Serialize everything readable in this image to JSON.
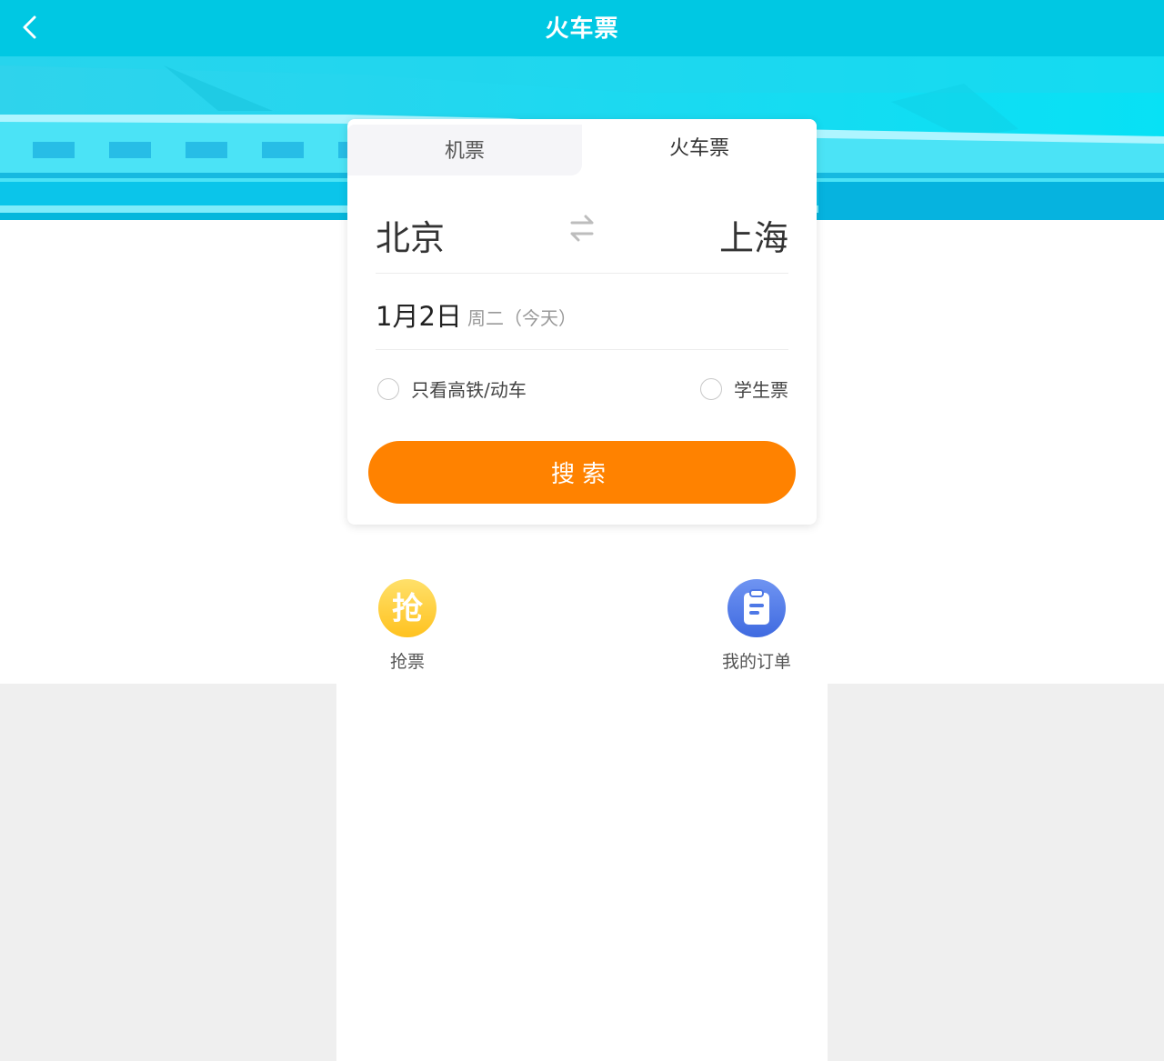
{
  "header": {
    "title": "火车票",
    "back_icon": "chevron-left-icon"
  },
  "colors": {
    "header_bg": "#00c8e3",
    "accent_orange": "#ff8200",
    "page_bg": "#efefef"
  },
  "tabs": [
    {
      "label": "机票",
      "active": false
    },
    {
      "label": "火车票",
      "active": true
    }
  ],
  "route": {
    "from": "北京",
    "to": "上海",
    "swap_icon": "swap-arrows-icon"
  },
  "date": {
    "main": "1月2日",
    "sub": "周二（今天）"
  },
  "options": {
    "high_speed_only": {
      "label": "只看高铁/动车",
      "checked": false
    },
    "student_ticket": {
      "label": "学生票",
      "checked": false
    }
  },
  "search": {
    "label": "搜索"
  },
  "entries": [
    {
      "label": "抢票",
      "icon": "grab-ticket-icon",
      "icon_text": "抢"
    },
    {
      "label": "我的订单",
      "icon": "clipboard-icon"
    }
  ]
}
